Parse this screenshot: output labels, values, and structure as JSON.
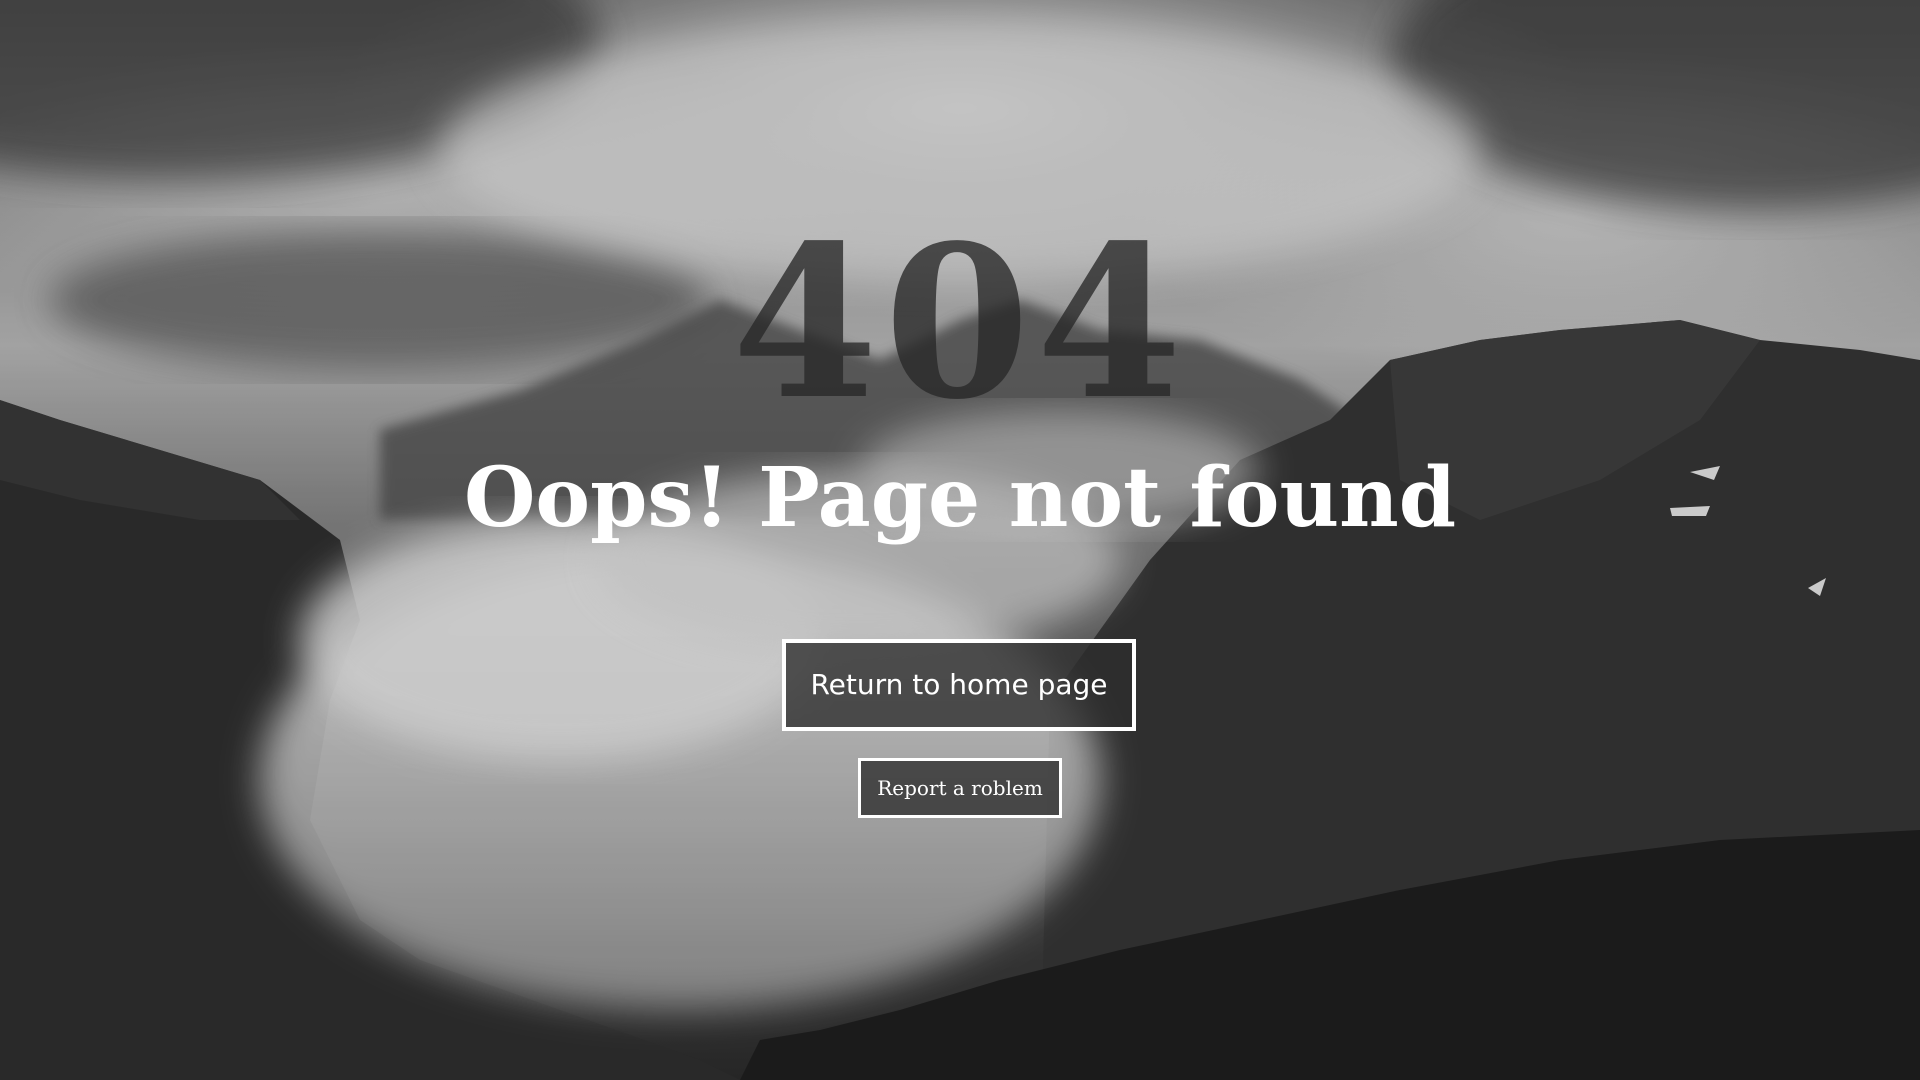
{
  "error_code": "404",
  "title": "Oops! Page not found",
  "buttons": {
    "home_label": "Return to home page",
    "report_label": "Report a roblem"
  },
  "theme": {
    "text_color": "#ffffff",
    "code_color": "#282828",
    "button_background": "#2d2d2d",
    "button_border": "#ffffff"
  },
  "background": {
    "description_icon": "mountain-fog-landscape-image"
  }
}
